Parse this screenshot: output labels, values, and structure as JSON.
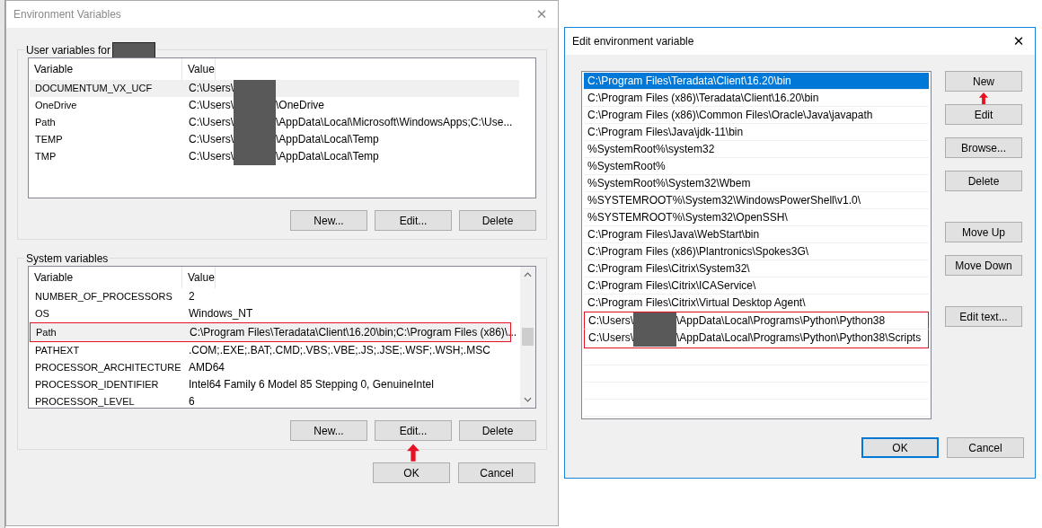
{
  "env_dialog": {
    "title": "Environment Variables",
    "close": "✕",
    "user_group": {
      "label": "User variables for",
      "label_redacted": true,
      "columns": [
        "Variable",
        "Value"
      ],
      "rows": [
        {
          "name": "DOCUMENTUM_VX_UCF",
          "value_prefix": "C:\\Users\\",
          "redacted": true,
          "selected": true,
          "highlighted": false
        },
        {
          "name": "OneDrive",
          "value_prefix": "C:\\Users\\",
          "value_suffix": "\\OneDrive",
          "redacted": true,
          "selected": false,
          "highlighted": false
        },
        {
          "name": "Path",
          "value_prefix": "C:\\Users\\",
          "value_suffix": "\\AppData\\Local\\Microsoft\\WindowsApps;C:\\Use...",
          "redacted": true,
          "selected": false,
          "highlighted": false
        },
        {
          "name": "TEMP",
          "value_prefix": "C:\\Users\\",
          "value_suffix": "\\AppData\\Local\\Temp",
          "redacted": true,
          "selected": false,
          "highlighted": false
        },
        {
          "name": "TMP",
          "value_prefix": "C:\\Users\\",
          "value_suffix": "\\AppData\\Local\\Temp",
          "redacted": true,
          "selected": false,
          "highlighted": false
        }
      ],
      "buttons": [
        {
          "label": "New...",
          "pointed": false
        },
        {
          "label": "Edit...",
          "pointed": false
        },
        {
          "label": "Delete",
          "pointed": false
        }
      ]
    },
    "system_group": {
      "label": "System variables",
      "columns": [
        "Variable",
        "Value"
      ],
      "rows": [
        {
          "name": "NUMBER_OF_PROCESSORS",
          "value_prefix": "2",
          "redacted": false,
          "selected": false,
          "highlighted": false
        },
        {
          "name": "OS",
          "value_prefix": "Windows_NT",
          "redacted": false,
          "selected": false,
          "highlighted": false
        },
        {
          "name": "Path",
          "value_prefix": "C:\\Program Files\\Teradata\\Client\\16.20\\bin;C:\\Program Files (x86)\\...",
          "redacted": false,
          "selected": true,
          "highlighted": true
        },
        {
          "name": "PATHEXT",
          "value_prefix": ".COM;.EXE;.BAT;.CMD;.VBS;.VBE;.JS;.JSE;.WSF;.WSH;.MSC",
          "redacted": false,
          "selected": false,
          "highlighted": false
        },
        {
          "name": "PROCESSOR_ARCHITECTURE",
          "value_prefix": "AMD64",
          "redacted": false,
          "selected": false,
          "highlighted": false
        },
        {
          "name": "PROCESSOR_IDENTIFIER",
          "value_prefix": "Intel64 Family 6 Model 85 Stepping 0, GenuineIntel",
          "redacted": false,
          "selected": false,
          "highlighted": false
        },
        {
          "name": "PROCESSOR_LEVEL",
          "value_prefix": "6",
          "redacted": false,
          "selected": false,
          "highlighted": false
        }
      ],
      "buttons": [
        {
          "label": "New...",
          "pointed": false
        },
        {
          "label": "Edit...",
          "pointed": true
        },
        {
          "label": "Delete",
          "pointed": false
        }
      ]
    },
    "footer_buttons": [
      {
        "label": "OK",
        "default": false
      },
      {
        "label": "Cancel",
        "default": false
      }
    ]
  },
  "edit_dialog": {
    "title": "Edit environment variable",
    "close": "✕",
    "items": [
      {
        "prefix": "C:\\Program Files\\Teradata\\Client\\16.20\\bin",
        "redacted": false,
        "selected": true,
        "highlighted": false
      },
      {
        "prefix": "C:\\Program Files (x86)\\Teradata\\Client\\16.20\\bin",
        "redacted": false,
        "selected": false,
        "highlighted": false
      },
      {
        "prefix": "C:\\Program Files (x86)\\Common Files\\Oracle\\Java\\javapath",
        "redacted": false,
        "selected": false,
        "highlighted": false
      },
      {
        "prefix": "C:\\Program Files\\Java\\jdk-11\\bin",
        "redacted": false,
        "selected": false,
        "highlighted": false
      },
      {
        "prefix": "%SystemRoot%\\system32",
        "redacted": false,
        "selected": false,
        "highlighted": false
      },
      {
        "prefix": "%SystemRoot%",
        "redacted": false,
        "selected": false,
        "highlighted": false
      },
      {
        "prefix": "%SystemRoot%\\System32\\Wbem",
        "redacted": false,
        "selected": false,
        "highlighted": false
      },
      {
        "prefix": "%SYSTEMROOT%\\System32\\WindowsPowerShell\\v1.0\\",
        "redacted": false,
        "selected": false,
        "highlighted": false
      },
      {
        "prefix": "%SYSTEMROOT%\\System32\\OpenSSH\\",
        "redacted": false,
        "selected": false,
        "highlighted": false
      },
      {
        "prefix": "C:\\Program Files\\Java\\WebStart\\bin",
        "redacted": false,
        "selected": false,
        "highlighted": false
      },
      {
        "prefix": "C:\\Program Files (x86)\\Plantronics\\Spokes3G\\",
        "redacted": false,
        "selected": false,
        "highlighted": false
      },
      {
        "prefix": "C:\\Program Files\\Citrix\\System32\\",
        "redacted": false,
        "selected": false,
        "highlighted": false
      },
      {
        "prefix": "C:\\Program Files\\Citrix\\ICAService\\",
        "redacted": false,
        "selected": false,
        "highlighted": false
      },
      {
        "prefix": "C:\\Program Files\\Citrix\\Virtual Desktop Agent\\",
        "redacted": false,
        "selected": false,
        "highlighted": false
      },
      {
        "prefix": "C:\\Users\\",
        "suffix": "\\AppData\\Local\\Programs\\Python\\Python38",
        "redacted": true,
        "selected": false,
        "highlighted": true
      },
      {
        "prefix": "C:\\Users\\",
        "suffix": "\\AppData\\Local\\Programs\\Python\\Python38\\Scripts",
        "redacted": true,
        "selected": false,
        "highlighted": true
      }
    ],
    "side_button_groups": [
      [
        {
          "label": "New",
          "pointed": true
        },
        {
          "label": "Edit",
          "pointed": false
        },
        {
          "label": "Browse...",
          "pointed": false
        },
        {
          "label": "Delete",
          "pointed": false
        }
      ],
      [
        {
          "label": "Move Up",
          "pointed": false
        },
        {
          "label": "Move Down",
          "pointed": false
        }
      ],
      [
        {
          "label": "Edit text...",
          "pointed": false
        }
      ]
    ],
    "footer_buttons": [
      {
        "label": "OK",
        "default": true
      },
      {
        "label": "Cancel",
        "default": false
      }
    ]
  }
}
